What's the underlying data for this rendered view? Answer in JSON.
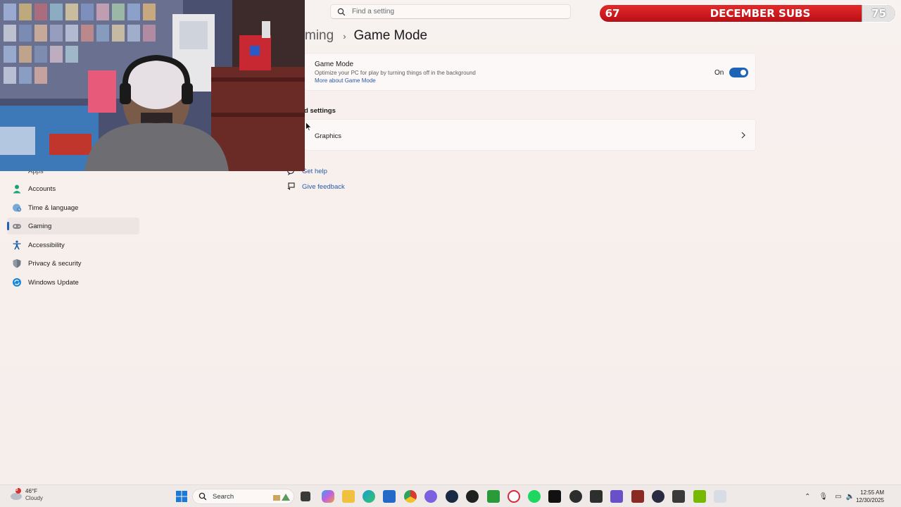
{
  "search": {
    "placeholder": "Find a setting"
  },
  "breadcrumb": {
    "parent": "ming",
    "current": "Game Mode"
  },
  "game_mode": {
    "title": "Game Mode",
    "description": "Optimize your PC for play by turning things off in the background",
    "link": "More about Game Mode",
    "state": "On",
    "enabled": true
  },
  "related": {
    "heading": "d settings",
    "graphics_label": "Graphics"
  },
  "help": {
    "get_help": "Get help",
    "give_feedback": "Give feedback"
  },
  "sidebar": {
    "items": [
      {
        "label": "Apps",
        "icon": "apps-icon"
      },
      {
        "label": "Accounts",
        "icon": "accounts-icon"
      },
      {
        "label": "Time & language",
        "icon": "time-language-icon"
      },
      {
        "label": "Gaming",
        "icon": "gaming-icon",
        "active": true
      },
      {
        "label": "Accessibility",
        "icon": "accessibility-icon"
      },
      {
        "label": "Privacy & security",
        "icon": "shield-icon"
      },
      {
        "label": "Windows Update",
        "icon": "update-icon"
      }
    ]
  },
  "sub_goal": {
    "current": "67",
    "title": "DECEMBER SUBS",
    "goal": "75"
  },
  "taskbar": {
    "weather_temp": "46°F",
    "weather_cond": "Cloudy",
    "weather_badge": "3",
    "search_label": "Search",
    "time": "12:55 AM",
    "date": "12/30/2025"
  },
  "colors": {
    "accent": "#1f63b7",
    "link": "#2a5aa8",
    "sub_bar": "#d81b22"
  }
}
